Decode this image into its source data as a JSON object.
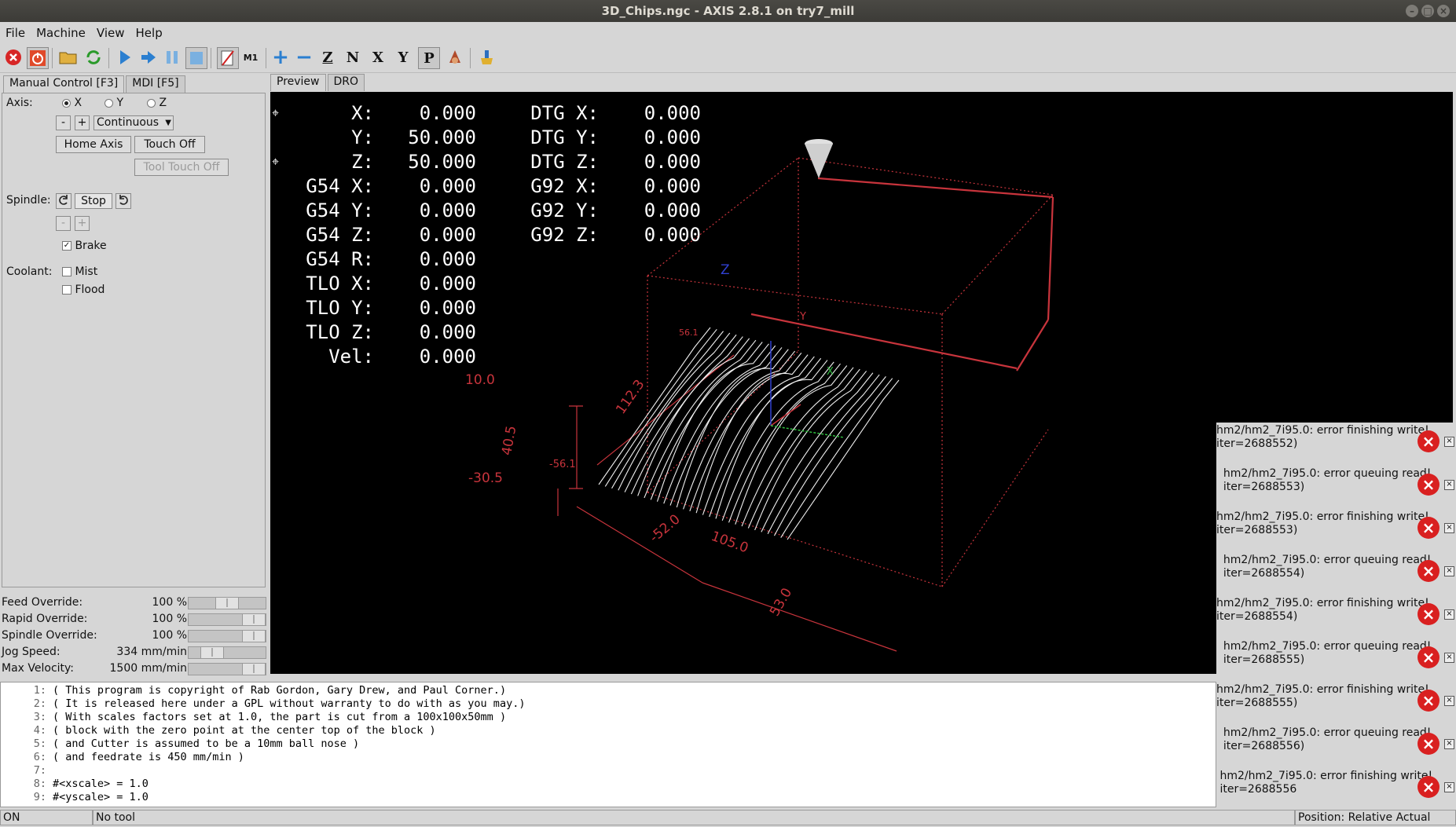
{
  "window": {
    "title": "3D_Chips.ngc - AXIS 2.8.1 on try7_mill"
  },
  "menu": [
    "File",
    "Machine",
    "View",
    "Help"
  ],
  "toolbar": {
    "icons": [
      "estop-icon",
      "power-icon",
      "open-file-icon",
      "reload-icon",
      "run-icon",
      "step-icon",
      "pause-icon",
      "stop-icon",
      "block-delete-icon",
      "optional-stop-icon",
      "zoom-in-icon",
      "zoom-out-icon",
      "view-z-icon",
      "view-z2-icon",
      "view-x-icon",
      "view-y-icon",
      "view-p-icon",
      "rotate-icon",
      "clear-live-plot-icon"
    ],
    "view_labels": [
      "Z",
      "N",
      "X",
      "Y",
      "P"
    ],
    "mi_label": "M1"
  },
  "left_tabs": [
    "Manual Control [F3]",
    "MDI [F5]"
  ],
  "manual": {
    "axis_label": "Axis:",
    "axes": [
      "X",
      "Y",
      "Z"
    ],
    "selected_axis": "X",
    "jog_minus": "-",
    "jog_plus": "+",
    "jog_mode": "Continuous",
    "home_axis": "Home Axis",
    "touch_off": "Touch Off",
    "tool_touch_off": "Tool Touch Off",
    "spindle_label": "Spindle:",
    "spindle_stop": "Stop",
    "spindle_minus": "-",
    "spindle_plus": "+",
    "brake_label": "Brake",
    "brake_checked": true,
    "coolant_label": "Coolant:",
    "mist_label": "Mist",
    "flood_label": "Flood"
  },
  "overrides": [
    {
      "name": "Feed Override:",
      "value": "100 %",
      "level": 0.5
    },
    {
      "name": "Rapid Override:",
      "value": "100 %",
      "level": 1.0
    },
    {
      "name": "Spindle Override:",
      "value": "100 %",
      "level": 1.0
    },
    {
      "name": "Jog Speed:",
      "value": "334 mm/min",
      "level": 0.22
    },
    {
      "name": "Max Velocity:",
      "value": "1500 mm/min",
      "level": 1.0
    }
  ],
  "preview_tabs": [
    "Preview",
    "DRO"
  ],
  "dro": {
    "rows_left": [
      {
        "label": "X:",
        "value": "0.000"
      },
      {
        "label": "Y:",
        "value": "50.000"
      },
      {
        "label": "Z:",
        "value": "50.000"
      },
      {
        "label": "G54 X:",
        "value": "0.000"
      },
      {
        "label": "G54 Y:",
        "value": "0.000"
      },
      {
        "label": "G54 Z:",
        "value": "0.000"
      },
      {
        "label": "G54 R:",
        "value": "0.000"
      },
      {
        "label": "TLO X:",
        "value": "0.000"
      },
      {
        "label": "TLO Y:",
        "value": "0.000"
      },
      {
        "label": "TLO Z:",
        "value": "0.000"
      },
      {
        "label": "Vel:",
        "value": "0.000"
      }
    ],
    "rows_right": [
      {
        "label": "DTG X:",
        "value": "0.000"
      },
      {
        "label": "DTG Y:",
        "value": "0.000"
      },
      {
        "label": "DTG Z:",
        "value": "0.000"
      },
      {
        "label": "G92 X:",
        "value": "0.000"
      },
      {
        "label": "G92 Y:",
        "value": "0.000"
      },
      {
        "label": "G92 Z:",
        "value": "0.000"
      }
    ]
  },
  "plot_labels": {
    "z_top": "10.0",
    "z_mid": "40.5",
    "z_bot": "-30.5",
    "y_len": "112.3",
    "x_len": "105.0",
    "x_min": "-52.0",
    "x_max": "53.0",
    "y_min": "-56.1",
    "y_max": "56.1",
    "axis_z": "Z",
    "axis_y": "Y",
    "axis_x": "X"
  },
  "code_lines": [
    {
      "n": "1:",
      "t": "( This program is copyright of Rab Gordon, Gary Drew, and Paul Corner.)"
    },
    {
      "n": "2:",
      "t": "( It is released here under a GPL without warranty to do with as you may.)"
    },
    {
      "n": "3:",
      "t": "( With scales factors set at 1.0, the part is cut from a 100x100x50mm )"
    },
    {
      "n": "4:",
      "t": "( block with the zero point at the center top of the block )"
    },
    {
      "n": "5:",
      "t": "( and Cutter is assumed to be a 10mm ball nose )"
    },
    {
      "n": "6:",
      "t": "( and feedrate is 450 mm/min )"
    },
    {
      "n": "7:",
      "t": ""
    },
    {
      "n": "8:",
      "t": "#<xscale> = 1.0"
    },
    {
      "n": "9:",
      "t": "#<yscale> = 1.0"
    }
  ],
  "notifications": [
    {
      "line1": "hm2/hm2_7i95.0: error finishing write!",
      "line2": "iter=2688552)"
    },
    {
      "line1": "  hm2/hm2_7i95.0: error queuing read!",
      "line2": "  iter=2688553)"
    },
    {
      "line1": "hm2/hm2_7i95.0: error finishing write!",
      "line2": "iter=2688553)"
    },
    {
      "line1": "  hm2/hm2_7i95.0: error queuing read!",
      "line2": "  iter=2688554)"
    },
    {
      "line1": "hm2/hm2_7i95.0: error finishing write!",
      "line2": "iter=2688554)"
    },
    {
      "line1": "  hm2/hm2_7i95.0: error queuing read!",
      "line2": "  iter=2688555)"
    },
    {
      "line1": "hm2/hm2_7i95.0: error finishing write!",
      "line2": "iter=2688555)"
    },
    {
      "line1": "  hm2/hm2_7i95.0: error queuing read!",
      "line2": "  iter=2688556)"
    },
    {
      "line1": " hm2/hm2_7i95.0: error finishing write!",
      "line2": " iter=2688556"
    }
  ],
  "status": {
    "machine": "ON",
    "tool": "No tool",
    "position": "Position: Relative Actual"
  },
  "colors": {
    "plot_red": "#c8343c",
    "toolpath": "#ffffff",
    "error_red": "#d92020"
  }
}
